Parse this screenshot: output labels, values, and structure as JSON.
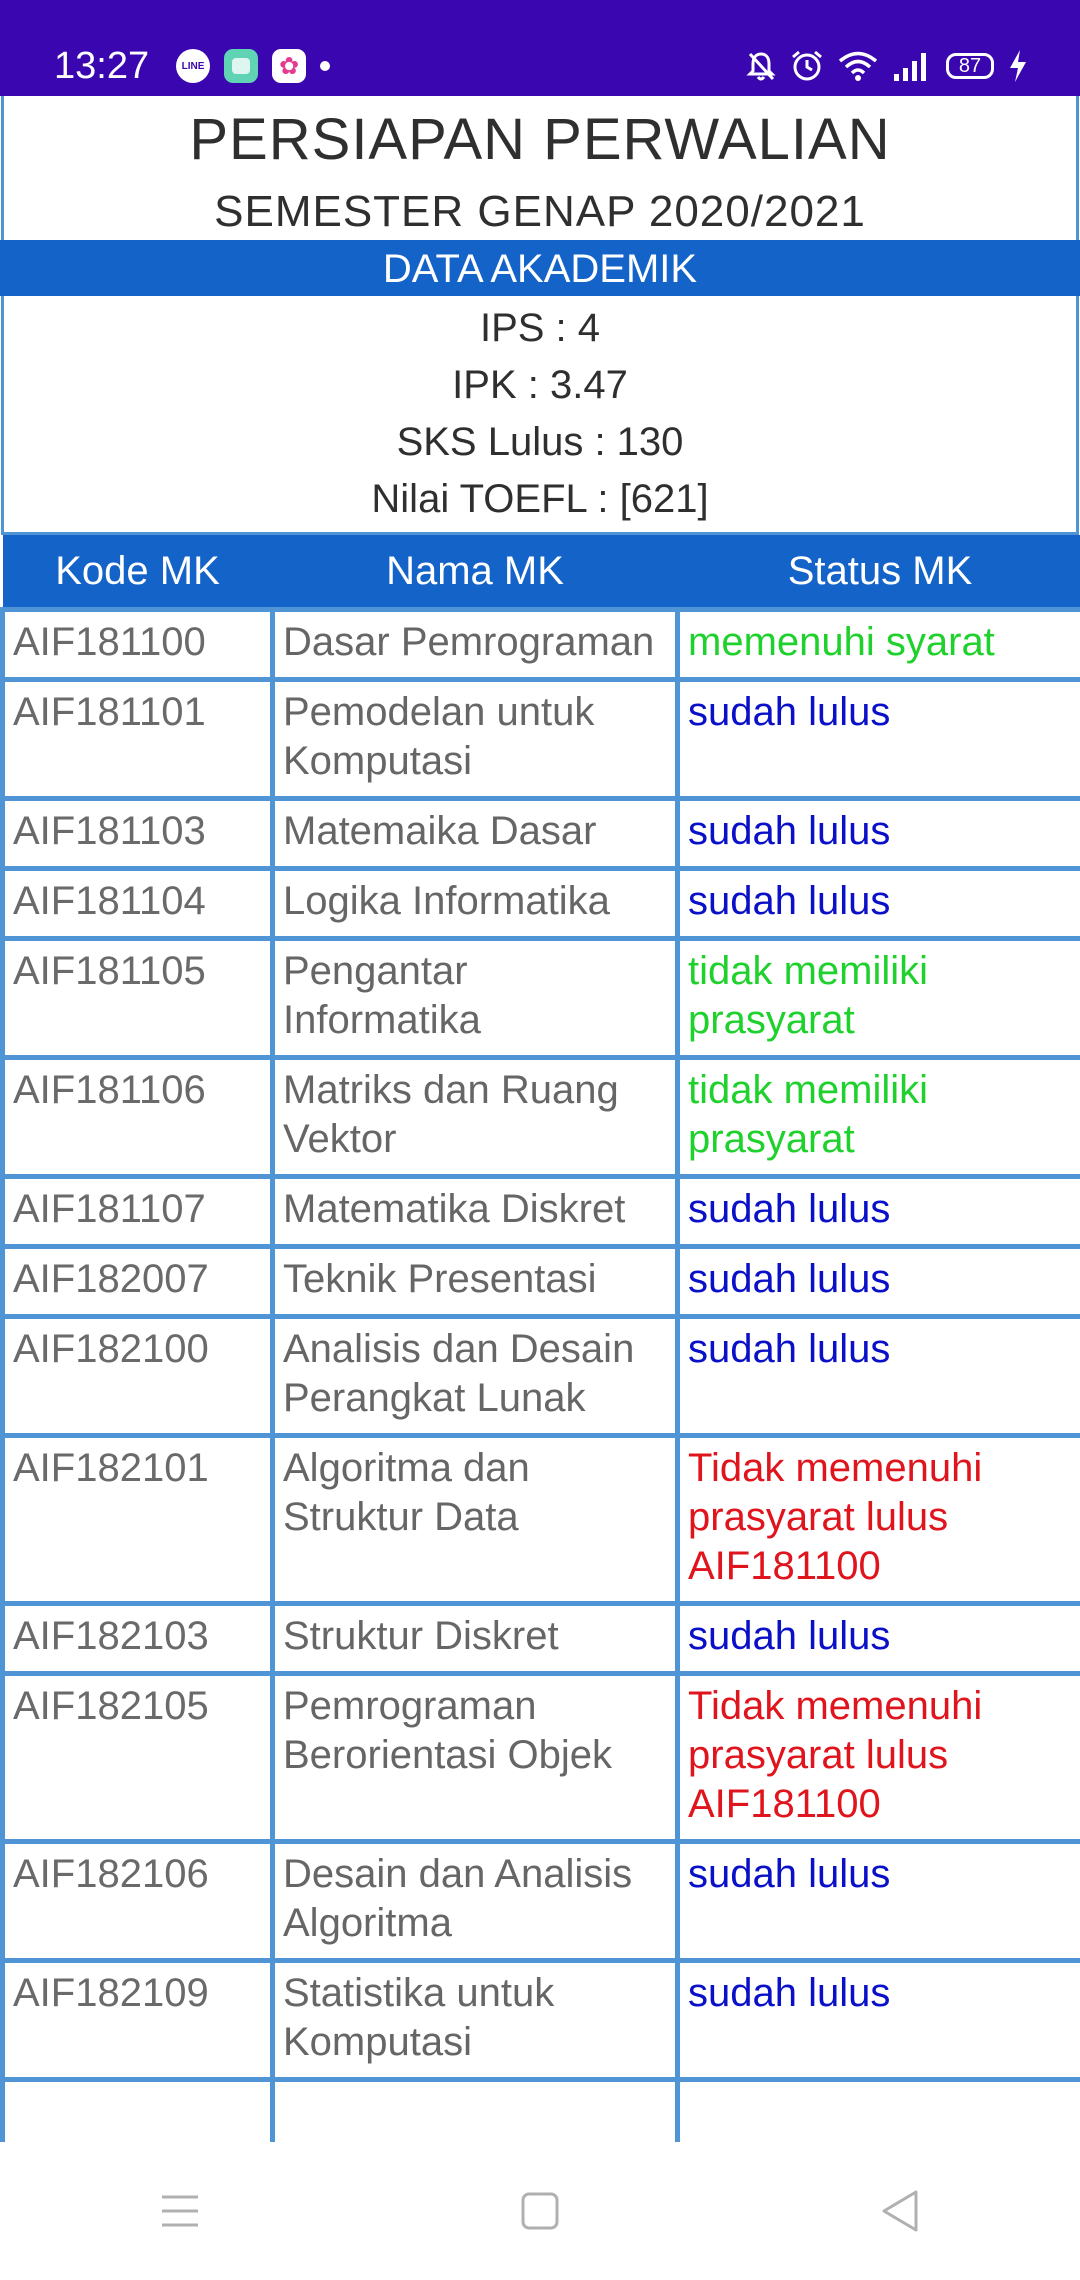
{
  "status_bar": {
    "time": "13:27",
    "notification_icons": [
      "line-icon",
      "chat-app-icon",
      "star-app-icon",
      "dot-icon"
    ],
    "system_icons": [
      "mute-icon",
      "alarm-icon",
      "wifi-icon",
      "signal-icon",
      "battery-icon",
      "charging-icon"
    ],
    "battery_level": "87"
  },
  "page": {
    "title": "PERSIAPAN PERWALIAN",
    "subtitle": "SEMESTER GENAP 2020/2021",
    "section_label": "DATA AKADEMIK",
    "ips": "IPS : 4",
    "ipk": "IPK : 3.47",
    "sks": "SKS Lulus : 130",
    "toefl": "Nilai TOEFL : [621]"
  },
  "table": {
    "headers": [
      "Kode MK",
      "Nama MK",
      "Status MK"
    ],
    "rows": [
      {
        "code": "AIF181100",
        "name": "Dasar Pemrograman",
        "status": "memenuhi syarat",
        "status_color": "#1fd12c"
      },
      {
        "code": "AIF181101",
        "name": "Pemodelan untuk Komputasi",
        "status": "sudah lulus",
        "status_color": "#0a10c8"
      },
      {
        "code": "AIF181103",
        "name": "Matemaika Dasar",
        "status": "sudah lulus",
        "status_color": "#0a10c8"
      },
      {
        "code": "AIF181104",
        "name": "Logika Informatika",
        "status": "sudah lulus",
        "status_color": "#0a10c8"
      },
      {
        "code": "AIF181105",
        "name": "Pengantar Informatika",
        "status": "tidak memiliki prasyarat",
        "status_color": "#1fd12c"
      },
      {
        "code": "AIF181106",
        "name": "Matriks dan Ruang Vektor",
        "status": "tidak memiliki prasyarat",
        "status_color": "#1fd12c"
      },
      {
        "code": "AIF181107",
        "name": "Matematika Diskret",
        "status": "sudah lulus",
        "status_color": "#0a10c8"
      },
      {
        "code": "AIF182007",
        "name": "Teknik Presentasi",
        "status": "sudah lulus",
        "status_color": "#0a10c8"
      },
      {
        "code": "AIF182100",
        "name": "Analisis dan Desain Perangkat Lunak",
        "status": "sudah lulus",
        "status_color": "#0a10c8"
      },
      {
        "code": "AIF182101",
        "name": "Algoritma dan Struktur Data",
        "status": "Tidak memenuhi prasyarat lulus AIF181100",
        "status_color": "#e0141c"
      },
      {
        "code": "AIF182103",
        "name": "Struktur Diskret",
        "status": "sudah lulus",
        "status_color": "#0a10c8"
      },
      {
        "code": "AIF182105",
        "name": "Pemrograman Berorientasi Objek",
        "status": "Tidak memenuhi prasyarat lulus AIF181100",
        "status_color": "#e0141c"
      },
      {
        "code": "AIF182106",
        "name": "Desain dan Analisis Algoritma",
        "status": "sudah lulus",
        "status_color": "#0a10c8"
      },
      {
        "code": "AIF182109",
        "name": "Statistika untuk Komputasi",
        "status": "sudah lulus",
        "status_color": "#0a10c8"
      },
      {
        "code": "",
        "name": "",
        "status": "",
        "status_color": "#0a10c8"
      }
    ]
  },
  "nav_bar": {
    "buttons": [
      "menu-icon",
      "home-icon",
      "back-icon"
    ]
  }
}
